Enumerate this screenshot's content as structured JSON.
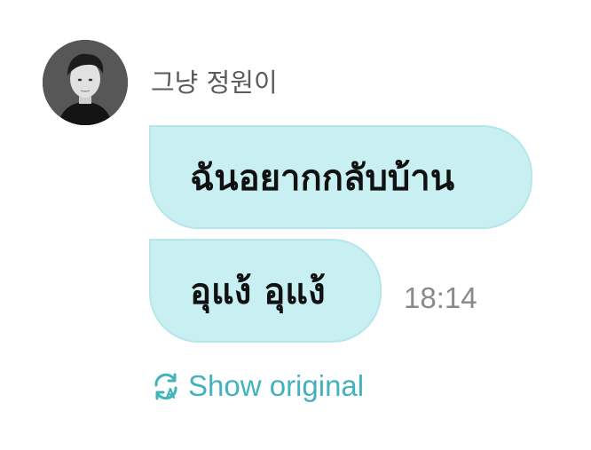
{
  "sender": {
    "name": "그냥 정원이",
    "avatar_icon": "profile-photo"
  },
  "messages": [
    {
      "text": "ฉันอยากกลับบ้าน"
    },
    {
      "text": "อุแง้ อุแง้",
      "time": "18:14"
    }
  ],
  "translation_action": {
    "icon": "translate-refresh-icon",
    "label": "Show original"
  },
  "colors": {
    "bubble": "#c8f0f3",
    "accent": "#42b3bc",
    "timestamp": "#8a8a8a"
  }
}
